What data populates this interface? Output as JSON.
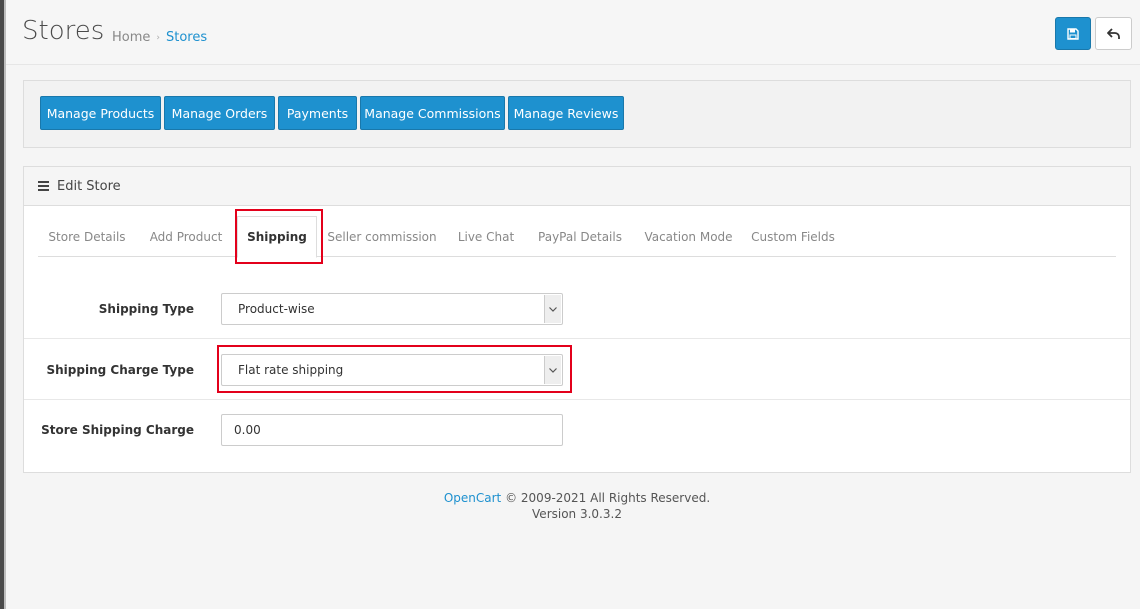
{
  "header": {
    "title": "Stores",
    "breadcrumb": {
      "home": "Home",
      "separator": "›",
      "current": "Stores"
    },
    "buttons": {
      "save_icon": "save-icon",
      "back_icon": "reply-icon"
    }
  },
  "actions": [
    {
      "label": "Manage Products"
    },
    {
      "label": "Manage Orders"
    },
    {
      "label": "Payments"
    },
    {
      "label": "Manage Commissions"
    },
    {
      "label": "Manage Reviews"
    }
  ],
  "panel": {
    "title": "Edit Store",
    "tabs": [
      {
        "label": "Store Details"
      },
      {
        "label": "Add Product"
      },
      {
        "label": "Shipping"
      },
      {
        "label": "Seller commission"
      },
      {
        "label": "Live Chat"
      },
      {
        "label": "PayPal Details"
      },
      {
        "label": "Vacation Mode"
      },
      {
        "label": "Custom Fields"
      }
    ],
    "active_tab": "Shipping",
    "form": {
      "shipping_type": {
        "label": "Shipping Type",
        "value": "Product-wise"
      },
      "shipping_charge_type": {
        "label": "Shipping Charge Type",
        "value": "Flat rate shipping"
      },
      "store_shipping_charge": {
        "label": "Store Shipping Charge",
        "value": "0.00"
      }
    }
  },
  "footer": {
    "link": "OpenCart",
    "copyright": "© 2009-2021 All Rights Reserved.",
    "version": "Version 3.0.3.2"
  },
  "colors": {
    "primary": "#1e91cf",
    "highlight": "#e3001b"
  }
}
